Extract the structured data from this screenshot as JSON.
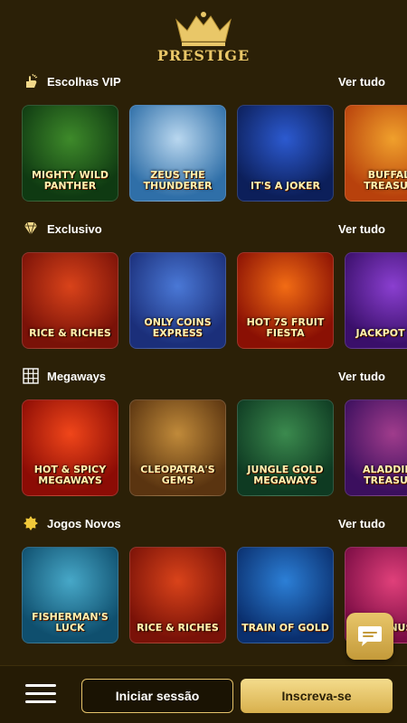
{
  "brand": {
    "name": "PRESTIGE",
    "color": "#e9c768"
  },
  "sections": [
    {
      "title": "Escolhas VIP",
      "icon": "vip-hand-icon",
      "see_all": "Ver tudo",
      "games": [
        {
          "name": "Mighty Wild Panther",
          "bg": [
            "#0f3a12",
            "#3e8a2a"
          ]
        },
        {
          "name": "Zeus the Thunderer",
          "bg": [
            "#2f6fa8",
            "#b9d7ef"
          ]
        },
        {
          "name": "It's a Joker",
          "bg": [
            "#0c1f5a",
            "#2c5ad0"
          ]
        },
        {
          "name": "Buffalo Treasure",
          "bg": [
            "#b8410c",
            "#f0a02c"
          ]
        }
      ]
    },
    {
      "title": "Exclusivo",
      "icon": "diamond-icon",
      "see_all": "Ver tudo",
      "games": [
        {
          "name": "Rice & Riches",
          "bg": [
            "#7a1208",
            "#d9431a"
          ]
        },
        {
          "name": "Only Coins Express",
          "bg": [
            "#1b2f7a",
            "#4a78d6"
          ]
        },
        {
          "name": "Hot 7s Fruit Fiesta",
          "bg": [
            "#8a1004",
            "#f26c14"
          ]
        },
        {
          "name": "Jackpot XXL",
          "bg": [
            "#3a0f6a",
            "#8a3fd0"
          ]
        }
      ]
    },
    {
      "title": "Megaways",
      "icon": "grid-icon",
      "see_all": "Ver tudo",
      "games": [
        {
          "name": "Hot & Spicy Megaways",
          "bg": [
            "#8c0c05",
            "#f0461a"
          ]
        },
        {
          "name": "Cleopatra's Gems",
          "bg": [
            "#5a3410",
            "#c08a3a"
          ]
        },
        {
          "name": "Jungle Gold Megaways",
          "bg": [
            "#0e3a22",
            "#3b8a4e"
          ]
        },
        {
          "name": "Aladdin's Treasure",
          "bg": [
            "#3b0f5e",
            "#a03c8c"
          ]
        }
      ]
    },
    {
      "title": "Jogos Novos",
      "icon": "sun-icon",
      "see_all": "Ver tudo",
      "games": [
        {
          "name": "Fisherman's Luck",
          "bg": [
            "#0f4f6e",
            "#47a8c8"
          ]
        },
        {
          "name": "Rice & Riches",
          "bg": [
            "#7a1208",
            "#d9431a"
          ]
        },
        {
          "name": "Train of Gold",
          "bg": [
            "#0a2f6e",
            "#2c7fd6"
          ]
        },
        {
          "name": "Bonus",
          "bg": [
            "#7a0c44",
            "#e0407a"
          ]
        }
      ]
    }
  ],
  "footer": {
    "login_label": "Iniciar sessão",
    "signup_label": "Inscreva-se"
  },
  "colors": {
    "background": "#2b2007",
    "accent_gold": "#e5c36b"
  }
}
